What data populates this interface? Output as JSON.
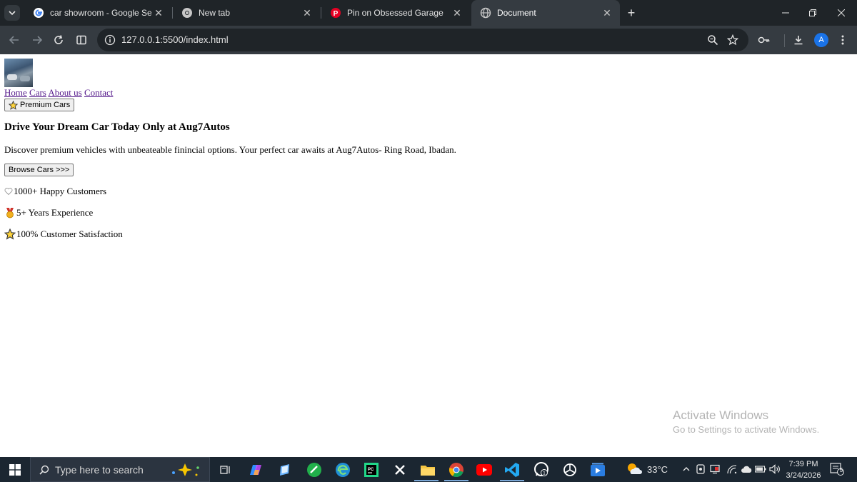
{
  "browser": {
    "tabs": [
      {
        "title": "car showroom - Google Search",
        "icon": "google-icon",
        "active": false
      },
      {
        "title": "New tab",
        "icon": "chrome-icon",
        "active": false
      },
      {
        "title": "Pin on Obsessed Garage",
        "icon": "pinterest-icon",
        "active": false
      },
      {
        "title": "Document",
        "icon": "globe-icon",
        "active": true
      }
    ],
    "url": "127.0.0.1:5500/index.html",
    "profile_initial": "A",
    "colors": {
      "tabbar": "#1f2428",
      "toolbar": "#353b41",
      "active_tab": "#353b41"
    }
  },
  "page": {
    "nav": [
      "Home",
      "Cars",
      "About us",
      "Contact"
    ],
    "premium_button": "Premium Cars",
    "headline": "Drive Your Dream Car Today Only at Aug7Autos",
    "description": "Discover premium vehicles with unbeateable finincial options. Your perfect car awaits at Aug7Autos- Ring Road, Ibadan.",
    "browse_button": "Browse Cars >>>",
    "stats": [
      {
        "icon": "heart-icon",
        "text": "1000+ Happy Customers"
      },
      {
        "icon": "medal-icon",
        "text": "5+ Years Experience"
      },
      {
        "icon": "star-icon",
        "text": "100% Customer Satisfaction"
      }
    ],
    "link_color": "#551a8b"
  },
  "watermark": {
    "title": "Activate Windows",
    "subtitle": "Go to Settings to activate Windows."
  },
  "taskbar": {
    "search_placeholder": "Type here to search",
    "temperature": "33°C",
    "time": "7:39 PM",
    "date": "3/24/2026",
    "notification_count": "5"
  }
}
